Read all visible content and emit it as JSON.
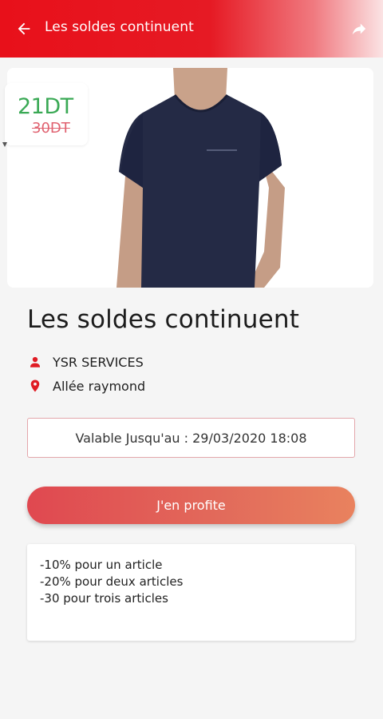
{
  "appbar": {
    "title": "Les soldes continuent",
    "back_icon": "arrow-left-icon",
    "share_icon": "share-icon"
  },
  "product": {
    "image": "navy-v-neck-tshirt-photo",
    "price_new": "21DT",
    "price_old": "30DT",
    "price_new_color": "#3aa955",
    "price_old_color": "#e06270"
  },
  "deal": {
    "title": "Les soldes continuent",
    "vendor": "YSR SERVICES",
    "address": "Allée raymond",
    "vendor_icon": "person-icon",
    "address_icon": "location-pin-icon",
    "validity": "Valable Jusqu'au : 29/03/2020 18:08",
    "cta_label": "J'en profite",
    "description": [
      "-10% pour un article",
      "-20% pour deux articles",
      "-30 pour trois articles"
    ]
  },
  "colors": {
    "accent": "#e8101a",
    "cta_start": "#e04850",
    "cta_end": "#e9825e"
  }
}
